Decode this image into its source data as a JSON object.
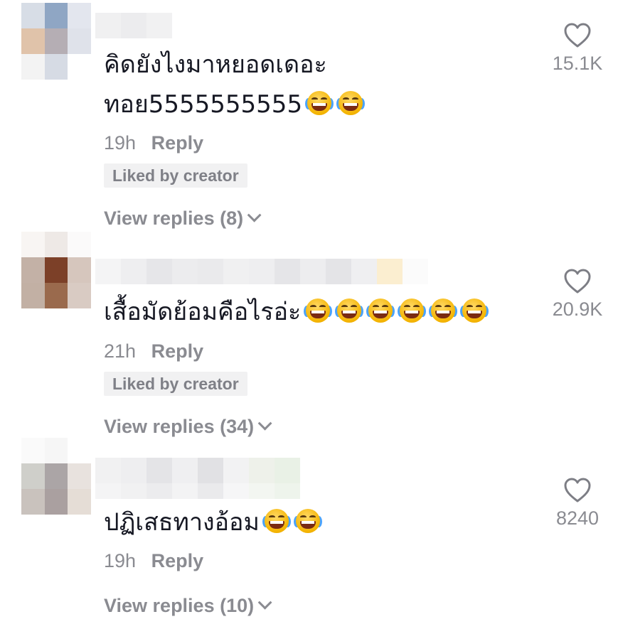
{
  "comments": [
    {
      "text": "คิดยังไงมาหยอดเดอะ",
      "text_line2": "ทอย5555555555",
      "emoji": "face-with-tears-of-joy",
      "emoji_count": 2,
      "time": "19h",
      "reply_label": "Reply",
      "liked_badge": "Liked by creator",
      "view_replies": "View replies (8)",
      "likes": "15.1K"
    },
    {
      "text": "เสื้อมัดย้อมคือไรอ่ะ",
      "emoji": "face-with-tears-of-joy",
      "emoji_count": 6,
      "time": "21h",
      "reply_label": "Reply",
      "liked_badge": "Liked by creator",
      "view_replies": "View replies (34)",
      "likes": "20.9K"
    },
    {
      "text": "ปฏิเสธทางอ้อม",
      "emoji": "face-with-tears-of-joy",
      "emoji_count": 2,
      "time": "19h",
      "reply_label": "Reply",
      "view_replies": "View replies (10)",
      "likes": "8240"
    }
  ],
  "colors": {
    "text": "#161823",
    "muted": "#8a8b91",
    "badge_bg": "#f1f1f2"
  }
}
